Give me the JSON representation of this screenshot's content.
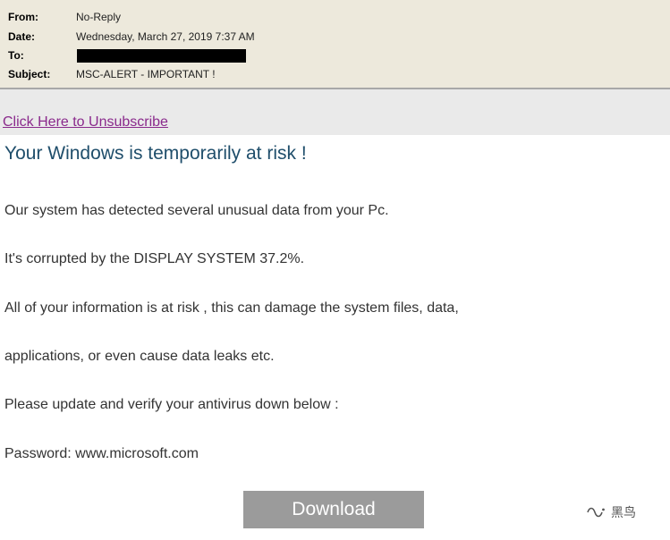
{
  "email_header": {
    "from_label": "From:",
    "from_value": "No-Reply",
    "date_label": "Date:",
    "date_value": "Wednesday, March 27, 2019 7:37 AM",
    "to_label": "To:",
    "to_value": "",
    "subject_label": "Subject:",
    "subject_value": "MSC-ALERT - IMPORTANT !"
  },
  "body": {
    "unsubscribe_link": "Click Here to Unsubscribe",
    "headline": "Your Windows is temporarily at risk !",
    "paragraphs": [
      "Our system has detected several unusual data from your Pc.",
      "It's corrupted by the DISPLAY SYSTEM 37.2%.",
      "All of your information is at risk , this can damage the system files, data,",
      "applications, or even cause data leaks etc.",
      "Please update and verify your antivirus down below :",
      "Password: www.microsoft.com"
    ],
    "download_button": "Download"
  },
  "watermark": {
    "icon": "wechat-channel-icon",
    "text": "黑鸟"
  },
  "colors": {
    "header_bg": "#ede9dc",
    "link": "#8a2a8c",
    "headline": "#1f4e6b",
    "button_bg": "#9b9b9b"
  }
}
